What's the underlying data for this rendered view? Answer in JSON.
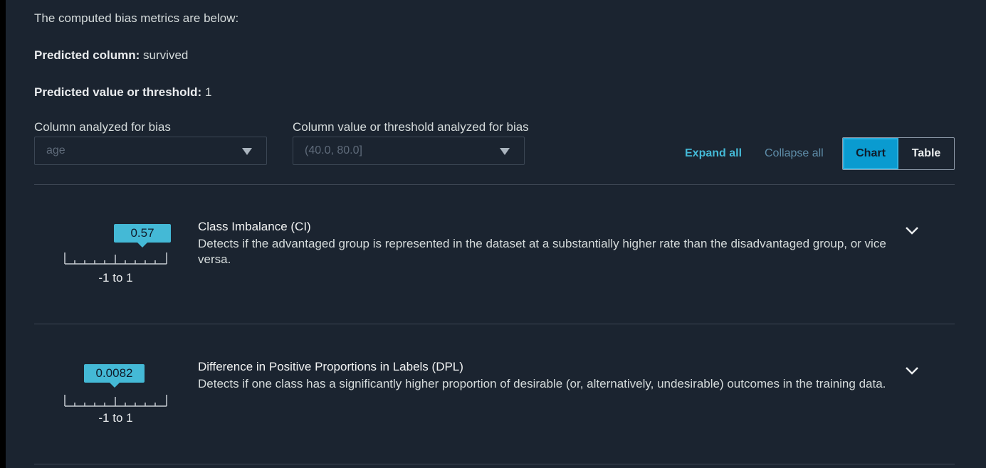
{
  "header": {
    "intro": "The computed bias metrics are below:",
    "predicted_column_label": "Predicted column:",
    "predicted_column_value": "survived",
    "predicted_threshold_label": "Predicted value or threshold:",
    "predicted_threshold_value": "1"
  },
  "filters": {
    "column_label": "Column analyzed for bias",
    "column_value": "age",
    "threshold_label": "Column value or threshold analyzed for bias",
    "threshold_value": "(40.0, 80.0]"
  },
  "controls": {
    "expand_all": "Expand all",
    "collapse_all": "Collapse all",
    "view_options": [
      "Chart",
      "Table"
    ],
    "selected_view": "Chart"
  },
  "metrics": [
    {
      "value": "0.57",
      "range": "-1 to 1",
      "title": "Class Imbalance (CI)",
      "description": "Detects if the advantaged group is represented in the dataset at a substantially higher rate than the disadvantaged group, or vice versa."
    },
    {
      "value": "0.0082",
      "range": "-1 to 1",
      "title": "Difference in Positive Proportions in Labels (DPL)",
      "description": "Detects if one class has a significantly higher proportion of desirable (or, alternatively, undesirable) outcomes in the training data."
    }
  ],
  "colors": {
    "background": "#1b2430",
    "accent": "#44b9d6",
    "selected_toggle": "#0a9bd0"
  }
}
